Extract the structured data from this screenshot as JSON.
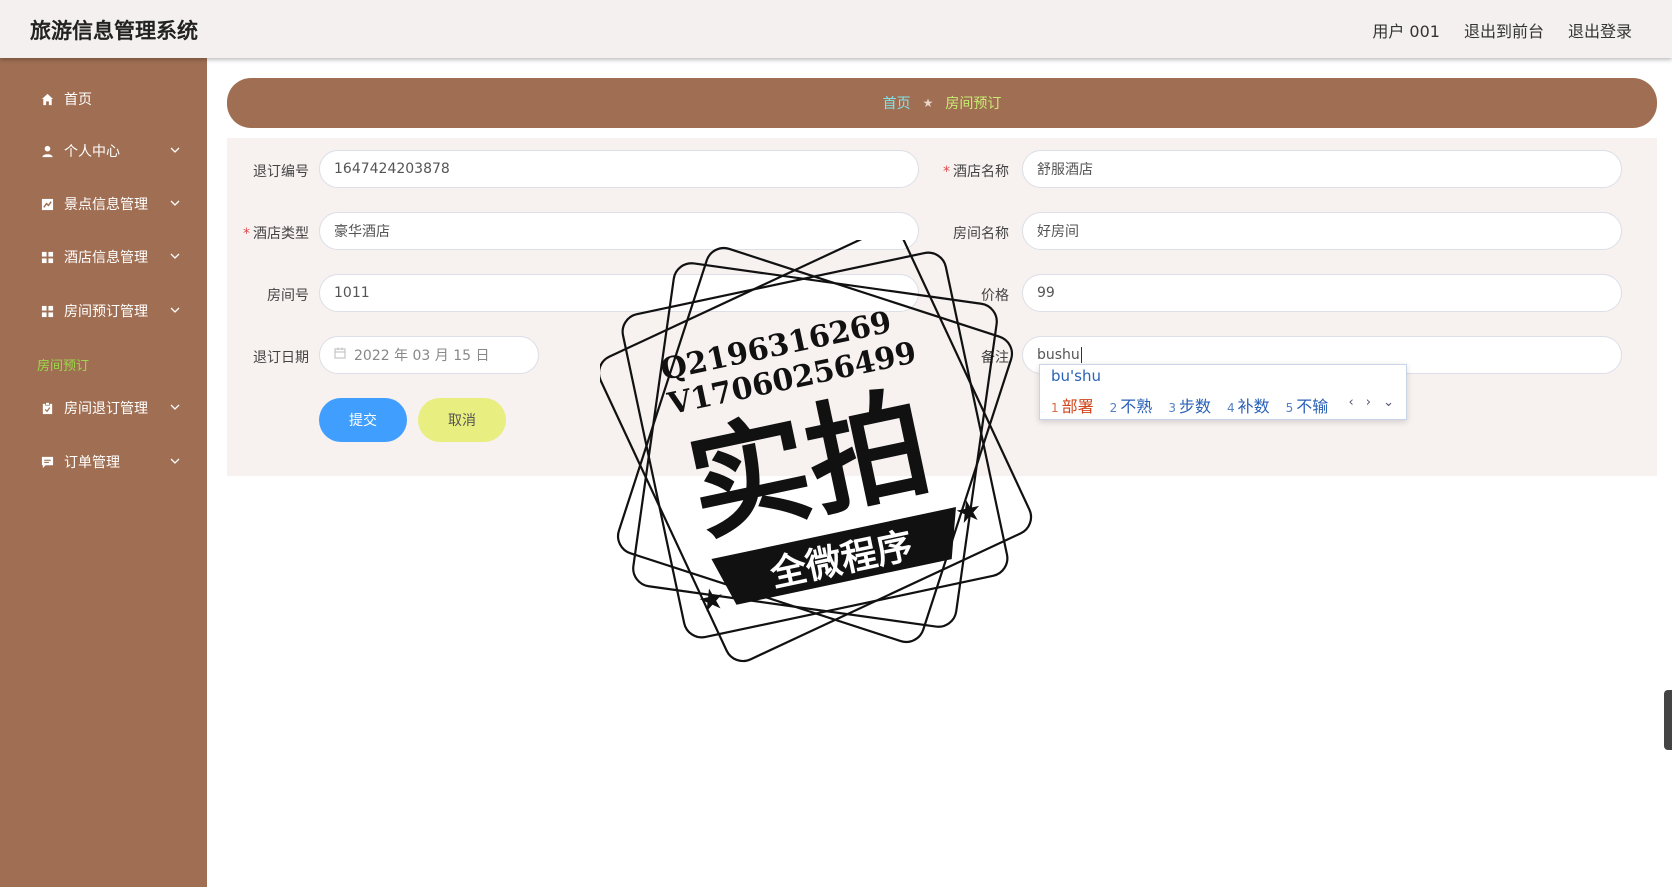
{
  "header": {
    "title": "旅游信息管理系统",
    "user": "用户 001",
    "to_front": "退出到前台",
    "logout": "退出登录"
  },
  "sidebar": {
    "items": [
      {
        "label": "首页",
        "icon": "home-icon"
      },
      {
        "label": "个人中心",
        "icon": "user-icon"
      },
      {
        "label": "景点信息管理",
        "icon": "chart-icon"
      },
      {
        "label": "酒店信息管理",
        "icon": "grid-icon"
      },
      {
        "label": "房间预订管理",
        "icon": "grid-icon"
      },
      {
        "label": "房间退订管理",
        "icon": "clipboard-icon"
      },
      {
        "label": "订单管理",
        "icon": "chat-icon"
      }
    ],
    "active_sub": "房间预订"
  },
  "breadcrumb": {
    "home": "首页",
    "current": "房间预订"
  },
  "form": {
    "refund_no_label": "退订编号",
    "refund_no": "1647424203878",
    "hotel_name_label": "酒店名称",
    "hotel_name": "舒服酒店",
    "hotel_type_label": "酒店类型",
    "hotel_type": "豪华酒店",
    "room_name_label": "房间名称",
    "room_name": "好房间",
    "room_no_label": "房间号",
    "room_no": "1011",
    "price_label": "价格",
    "price": "99",
    "date_label": "退订日期",
    "date": "2022 年 03 月 15 日",
    "remark_label": "备注",
    "remark": "bushu",
    "submit": "提交",
    "cancel": "取消"
  },
  "ime": {
    "pinyin": "bu'shu",
    "candidates": [
      {
        "n": "1",
        "text": "部署"
      },
      {
        "n": "2",
        "text": "不熟"
      },
      {
        "n": "3",
        "text": "步数"
      },
      {
        "n": "4",
        "text": "补数"
      },
      {
        "n": "5",
        "text": "不输"
      }
    ],
    "nav": "‹ › ⌄"
  },
  "watermark": {
    "line1": "Q2196316269",
    "line2": "V17060256499",
    "big": "实拍",
    "banner": "全微程序"
  },
  "colors": {
    "sidebar_bg": "#a06f53",
    "accent_blue": "#409eff",
    "cancel_yellow": "#e8ee7f"
  }
}
